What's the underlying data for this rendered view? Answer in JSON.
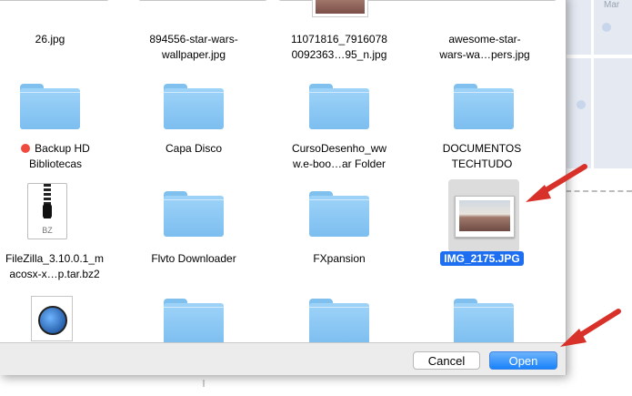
{
  "dialog": {
    "files": [
      {
        "name": "26.jpg",
        "kind": "image"
      },
      {
        "name": "894556-star-wars-\nwallpaper.jpg",
        "kind": "image"
      },
      {
        "name": "11071816_7916078\n0092363…95_n.jpg",
        "kind": "image"
      },
      {
        "name": "awesome-star-\nwars-wa…pers.jpg",
        "kind": "image"
      },
      {
        "name": "Backup HD\nBibliotecas",
        "kind": "folder",
        "tag_color": "#f04b3e"
      },
      {
        "name": "Capa Disco",
        "kind": "folder"
      },
      {
        "name": "CursoDesenho_ww\nw.e-boo…ar Folder",
        "kind": "folder"
      },
      {
        "name": "DOCUMENTOS\nTECHTUDO",
        "kind": "folder"
      },
      {
        "name": "FileZilla_3.10.0.1_m\nacosx-x…p.tar.bz2",
        "kind": "archive",
        "badge": "BZ"
      },
      {
        "name": "Flvto Downloader",
        "kind": "folder"
      },
      {
        "name": "FXpansion",
        "kind": "folder"
      },
      {
        "name": "IMG_2175.JPG",
        "kind": "image",
        "selected": true
      }
    ],
    "buttons": {
      "cancel": "Cancel",
      "open": "Open"
    },
    "accent_color": "#1d6ef0",
    "annotation_color": "#d7312a"
  },
  "background": {
    "map_label": "Mar"
  }
}
